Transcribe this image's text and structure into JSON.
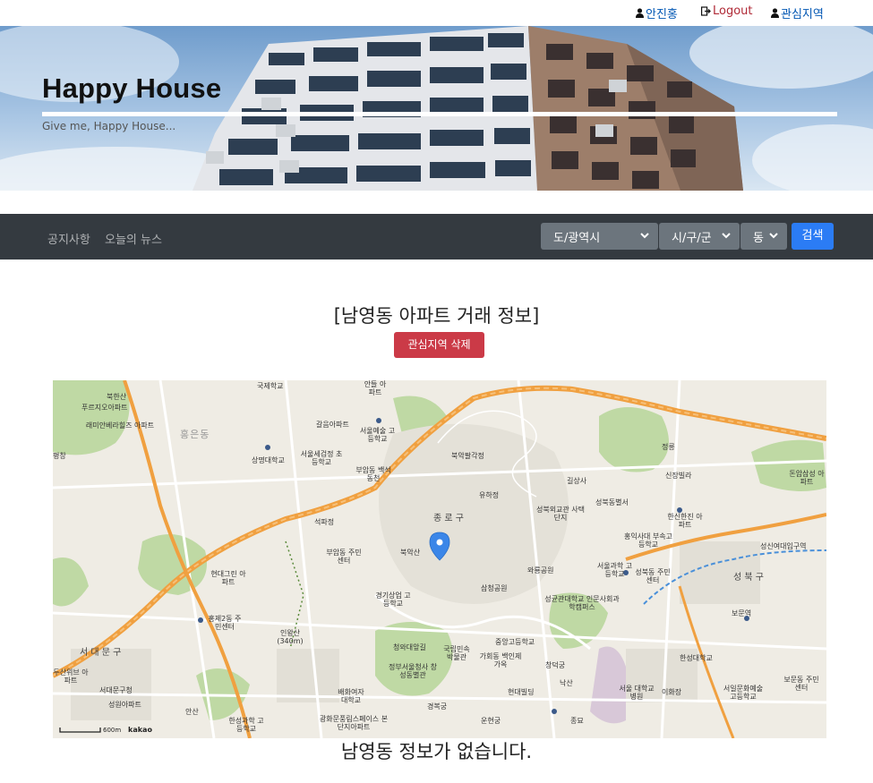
{
  "userbar": {
    "user_name": "안진홍",
    "logout_label": "Logout",
    "favorite_label": "관심지역"
  },
  "hero": {
    "title": "Happy House",
    "subtitle": "Give me, Happy House..."
  },
  "nav": {
    "links": [
      "공지사항",
      "오늘의 뉴스"
    ],
    "selects": {
      "province": "도/광역시",
      "city": "시/구/군",
      "dong": "동"
    },
    "search_label": "검색"
  },
  "main": {
    "title": "[남영동 아파트 거래 정보]",
    "delete_button": "관심지역 삭제",
    "no_info": "남영동 정보가 없습니다."
  },
  "map": {
    "scale_label": "600m",
    "provider": "kakao",
    "labels": {
      "bukhansan": "북한산",
      "purjio": "푸르지오아파트",
      "raemian_villaz": "래미안베라힐즈 아파트",
      "national_school": "국제학교",
      "anteul": "안들 아파트",
      "galeum": "갈음아파트",
      "seoul_arts": "서울예술 고등학교",
      "pyeongchang": "평창",
      "north_gate": "북악팔각정",
      "jongno_gu": "종 로 구",
      "bukaksan": "북악산",
      "yuhajeong": "유하정",
      "gilsang": "길상사",
      "seongbuk_villa": "성북동별서",
      "seongbuk_school": "성북외교관 사택단지",
      "seongbuk_dong_label": "성북동",
      "jeongneung": "정릉",
      "sinjang": "신장빌라",
      "seongbuk_gu": "성 북 구",
      "seongsin_univ": "성신여대입구역",
      "donam": "돈암삼성 아파트",
      "hansin": "한신한진 아파트",
      "hongik_school": "홍익사대 부속고등학교",
      "wallyong": "와룡공원",
      "seoul_sci": "서울과학 고등학교",
      "seongbuk_center": "성북동 주민센터",
      "sungkyunkwan": "성균관대학교 인문사회과학캠퍼스",
      "hyehwa": "혜화동",
      "buam": "부암동 주민센터",
      "buam_seokpa": "석파정",
      "sangmyung": "상명대학교",
      "seoul_sejeong": "서울세검정 초등학교",
      "buam_baeksuk": "부암동 백석동천",
      "hongeun": "홍은동",
      "hongje": "홍제2동 주민센터",
      "hyundai_green": "현대그린 아파트",
      "inwangsan": "인왕산 (340m)",
      "gyeonggi_sangup": "경기상업 고등학교",
      "cheongwadae": "청와대앞길",
      "national_folk": "국립민속 박물관",
      "gahoe": "가회동 백인제가옥",
      "changdeok": "창덕궁",
      "jungang_school": "중앙고등학교",
      "seodaemun": "서 대 문 구",
      "seodaemun_office": "서대문구청",
      "jeongbu": "정부서울청사 창성동별관",
      "baehwa": "배화여자 대학교",
      "gyeongbok": "경복궁",
      "hyundai_building": "현대빌딩",
      "seoul_hospital": "서울 대학교병원",
      "naksan": "낙산",
      "ehwa": "이화장",
      "hansung_univ": "한성대학교",
      "gwanghwamun": "광화문풍림스페이스 본단지아파트",
      "unhyeongung": "운현궁",
      "jongmyo": "종묘",
      "ansan": "안산",
      "hansung_school": "한성과학 고등학교",
      "dusan": "두산위브 아파트",
      "seongwon": "성원아파트",
      "samcheong": "삼청공원",
      "gamsa": "감사원",
      "boramae": "보문역",
      "seoil_art": "서일문화예술 고등학교",
      "bomun_center": "보문동 주민센터"
    }
  }
}
